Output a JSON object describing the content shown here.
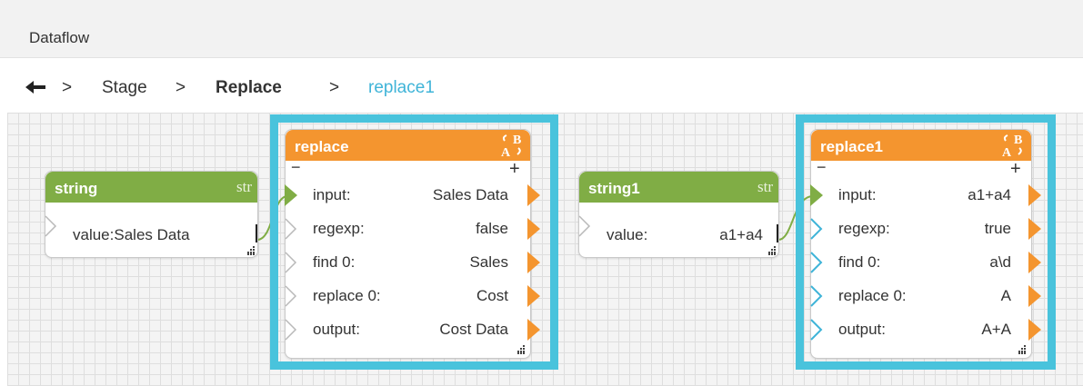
{
  "window": {
    "title": "Dataflow"
  },
  "breadcrumb": {
    "sep": ">",
    "items": [
      "Stage",
      "Replace",
      "replace1"
    ]
  },
  "nodes": {
    "string": {
      "title": "string",
      "type_tag": "str",
      "field_label": "value:",
      "field_value": "Sales Data"
    },
    "replace": {
      "title": "replace",
      "rows": [
        {
          "label": "input:",
          "value": "Sales Data"
        },
        {
          "label": "regexp:",
          "value": "false"
        },
        {
          "label": "find 0:",
          "value": "Sales"
        },
        {
          "label": "replace 0:",
          "value": "Cost"
        },
        {
          "label": "output:",
          "value": "Cost Data"
        }
      ]
    },
    "string1": {
      "title": "string1",
      "type_tag": "str",
      "field_label": "value:",
      "field_value": "a1+a4"
    },
    "replace1": {
      "title": "replace1",
      "rows": [
        {
          "label": "input:",
          "value": "a1+a4"
        },
        {
          "label": "regexp:",
          "value": "true"
        },
        {
          "label": "find 0:",
          "value": "a\\d"
        },
        {
          "label": "replace 0:",
          "value": "A"
        },
        {
          "label": "output:",
          "value": "A+A"
        }
      ]
    }
  },
  "icons": [
    "back-arrow-icon",
    "ab-type-icon",
    "input-port-icon",
    "output-port-icon",
    "resize-handle-icon",
    "add-port-icon",
    "remove-port-icon"
  ],
  "colors": {
    "node_header_string": "#80ad45",
    "node_header_replace": "#f4952f",
    "selection": "#49c3dc",
    "breadcrumb_current": "#3fb4d8",
    "wire": "#80ad45"
  }
}
